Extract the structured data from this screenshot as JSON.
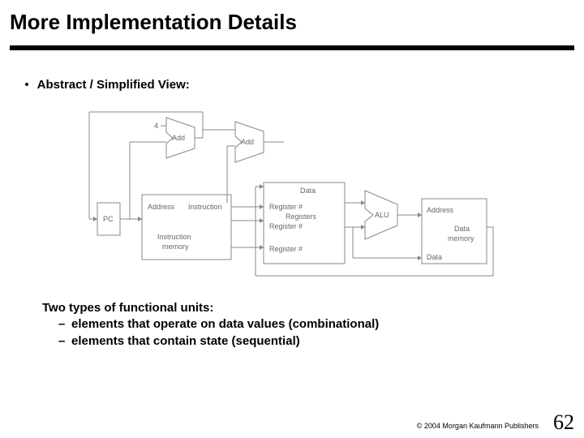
{
  "title": "More Implementation Details",
  "bullet1": "Abstract / Simplified View:",
  "diagram": {
    "const4": "4",
    "add1": "Add",
    "add2": "Add",
    "pc": "PC",
    "imem_addr": "Address",
    "imem_instr": "Instruction",
    "imem_name": "Instruction\nmemory",
    "reg_data": "Data",
    "reg_r1": "Register #",
    "reg_r2": "Register #",
    "reg_r3": "Register #",
    "reg_title": "Registers",
    "alu": "ALU",
    "dmem_addr": "Address",
    "dmem_name": "Data\nmemory",
    "dmem_data": "Data"
  },
  "body": {
    "line1": "Two types of functional units:",
    "line2": "elements that operate on data values (combinational)",
    "line3": "elements that contain state (sequential)"
  },
  "footer": "© 2004 Morgan Kaufmann Publishers",
  "page": "62"
}
